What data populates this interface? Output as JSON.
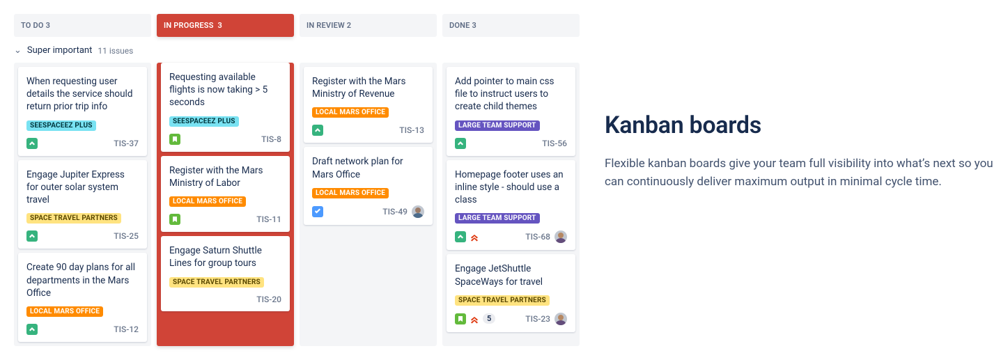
{
  "swimlane": {
    "name": "Super important",
    "count_label": "11 issues"
  },
  "columns": [
    {
      "title": "TO DO",
      "count": 3,
      "active": false
    },
    {
      "title": "IN PROGRESS",
      "count": 3,
      "active": true
    },
    {
      "title": "IN REVIEW",
      "count": 2,
      "active": false
    },
    {
      "title": "DONE",
      "count": 3,
      "active": false
    }
  ],
  "labels": {
    "seespaceez": "SEESPACEEZ PLUS",
    "partners": "SPACE TRAVEL PARTNERS",
    "mars": "LOCAL MARS OFFICE",
    "team": "LARGE TEAM SUPPORT"
  },
  "cards": {
    "todo": [
      {
        "title": "When requesting user details the service should return prior trip info",
        "label": "seespaceez",
        "label_cls": "l-cyan",
        "type": "story",
        "key": "TIS-37"
      },
      {
        "title": "Engage Jupiter Express for outer solar system travel",
        "label": "partners",
        "label_cls": "l-yellow",
        "type": "story",
        "key": "TIS-25"
      },
      {
        "title": "Create 90 day plans for all departments in the Mars Office",
        "label": "mars",
        "label_cls": "l-orange",
        "type": "story",
        "key": "TIS-12"
      }
    ],
    "progress": [
      {
        "title": "Requesting available flights is now taking > 5 seconds",
        "label": "seespaceez",
        "label_cls": "l-cyan",
        "type": "bookmark",
        "key": "TIS-8"
      },
      {
        "title": "Register with the Mars Ministry of Labor",
        "label": "mars",
        "label_cls": "l-orange",
        "type": "bookmark",
        "key": "TIS-11"
      },
      {
        "title": "Engage Saturn Shuttle Lines for group tours",
        "label": "partners",
        "label_cls": "l-yellow",
        "type": "none",
        "key": "TIS-20"
      }
    ],
    "review": [
      {
        "title": "Register with the Mars Ministry of Revenue",
        "label": "mars",
        "label_cls": "l-orange",
        "type": "story",
        "key": "TIS-13"
      },
      {
        "title": "Draft network plan for Mars Office",
        "label": "mars",
        "label_cls": "l-orange",
        "type": "task",
        "key": "TIS-49",
        "avatar": true
      }
    ],
    "done": [
      {
        "title": "Add pointer to main css file to instruct users to create child themes",
        "label": "team",
        "label_cls": "l-purple",
        "type": "story",
        "key": "TIS-56"
      },
      {
        "title": "Homepage footer uses an inline style - should use a class",
        "label": "team",
        "label_cls": "l-purple",
        "type": "story",
        "key": "TIS-68",
        "priority": "high",
        "avatar": "fem"
      },
      {
        "title": "Engage JetShuttle SpaceWays for travel",
        "label": "partners",
        "label_cls": "l-yellow",
        "type": "bookmark",
        "key": "TIS-23",
        "priority": "high",
        "badge": "5",
        "avatar": "fem"
      }
    ]
  },
  "feature": {
    "heading": "Kanban boards",
    "body": "Flexible kanban boards give your team full visibility into what’s next so you can continuously deliver maximum output in minimal cycle time."
  }
}
